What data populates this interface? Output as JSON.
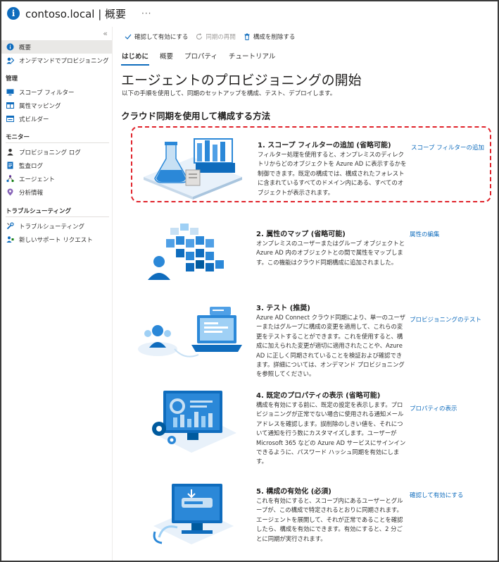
{
  "window": {
    "title": "contoso.local | 概要",
    "more": "···",
    "collapse": "«"
  },
  "sidebar": {
    "items": [
      {
        "label": "概要",
        "icon": "info-icon"
      },
      {
        "label": "オンデマンドでプロビジョニング",
        "icon": "provision-icon"
      }
    ],
    "sections": [
      {
        "title": "管理",
        "items": [
          {
            "label": "スコープ フィルター",
            "icon": "monitor-icon"
          },
          {
            "label": "属性マッピング",
            "icon": "table-icon"
          },
          {
            "label": "式ビルダー",
            "icon": "formula-icon"
          }
        ]
      },
      {
        "title": "モニター",
        "items": [
          {
            "label": "プロビジョニング ログ",
            "icon": "person-icon"
          },
          {
            "label": "監査ログ",
            "icon": "log-icon"
          },
          {
            "label": "エージェント",
            "icon": "agent-icon"
          },
          {
            "label": "分析情報",
            "icon": "insight-icon"
          }
        ]
      },
      {
        "title": "トラブルシューティング",
        "items": [
          {
            "label": "トラブルシューティング",
            "icon": "wrench-icon"
          },
          {
            "label": "新しいサポート リクエスト",
            "icon": "support-icon"
          }
        ]
      }
    ]
  },
  "toolbar": {
    "enable": "確認して有効にする",
    "restart": "同期の再開",
    "delete": "構成を削除する"
  },
  "tabs": [
    "はじめに",
    "概要",
    "プロパティ",
    "チュートリアル"
  ],
  "main": {
    "title": "エージェントのプロビジョニングの開始",
    "subtitle": "以下の手順を使用して、同期のセットアップを構成、テスト、デプロイします。",
    "section_title": "クラウド同期を使用して構成する方法"
  },
  "steps": [
    {
      "title": "1. スコープ フィルターの追加 (省略可能)",
      "desc": "フィルター処理を使用すると、オンプレミスのディレクトリからどのオブジェクトを Azure AD に表示するかを制御できます。既定の構成では、構成されたフォレストに含まれているすべてのドメイン内にある、すべてのオブジェクトが表示されます。",
      "link": "スコープ フィルターの追加",
      "illustration": "lab-flask-illustration"
    },
    {
      "title": "2. 属性のマップ (省略可能)",
      "desc": "オンプレミスのユーザーまたはグループ オブジェクトと Azure AD 内のオブジェクトとの間で属性をマップします。この機能はクラウド同期構成に追加されました。",
      "link": "属性の編集",
      "illustration": "attribute-map-illustration"
    },
    {
      "title": "3. テスト (推奨)",
      "desc": "Azure AD Connect クラウド同期により、単一のユーザーまたはグループに構成の変更を適用して、これらの変更をテストすることができます。これを使用すると、構成に加えられた変更が適切に適用されたことや、Azure AD に正しく同期されていることを検証および確認できます。詳細については、オンデマンド プロビジョニングを参照してください。",
      "link": "プロビジョニングのテスト",
      "illustration": "laptop-test-illustration"
    },
    {
      "title": "4. 既定のプロパティの表示 (省略可能)",
      "desc": "構成を有効にする前に、既定の設定を表示します。プロビジョニングが正常でない場合に使用される通知メール アドレスを確認します。誤削除のしきい値を、それについて通知を行う数にカスタマイズします。ユーザーが Microsoft 365 などの Azure AD サービスにサインインできるように、パスワード ハッシュ同期を有効にします。",
      "link": "プロパティの表示",
      "illustration": "dashboard-settings-illustration"
    },
    {
      "title": "5. 構成の有効化 (必須)",
      "desc": "これを有効にすると、スコープ内にあるユーザーとグループが、この構成で特定されるとおりに同期されます。エージェントを展開して、それが正常であることを確認したら、構成を有効にできます。有効にすると、2 分ごとに同期が実行されます。",
      "link": "確認して有効にする",
      "illustration": "enable-sync-illustration"
    }
  ],
  "colors": {
    "accent": "#0f6cbd",
    "highlight": "#e0232b",
    "illustration_blue": "#2b88d8",
    "illustration_light": "#c7e0f4"
  }
}
